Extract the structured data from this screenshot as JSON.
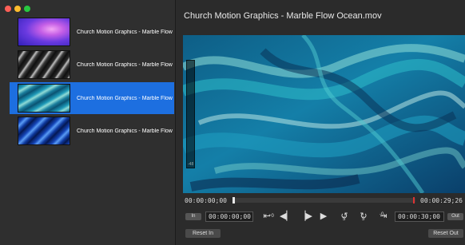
{
  "window": {
    "title": "Church Motion Graphics - Marble Flow Ocean.mov",
    "traffic_colors": [
      "#ff5f57",
      "#febc2e",
      "#28c840"
    ]
  },
  "playlist": {
    "items": [
      {
        "label": "Church Motion Graphics - Marble Flow Purple.mov",
        "selected": false,
        "thumb_colors": [
          "#4b2fd6",
          "#b04be0",
          "#e57fe8"
        ]
      },
      {
        "label": "Church Motion Graphics - Marble Flow Gray.mov",
        "selected": false,
        "thumb_colors": [
          "#1a1a1a",
          "#777777",
          "#d8d8d8"
        ]
      },
      {
        "label": "Church Motion Graphics - Marble Flow Ocean.mov",
        "selected": true,
        "thumb_colors": [
          "#0d6b8a",
          "#2bb3c9",
          "#a7e3e0"
        ]
      },
      {
        "label": "Church Motion Graphics - Marble Flow Blue.mov",
        "selected": false,
        "thumb_colors": [
          "#0a2a7a",
          "#1f5fd6",
          "#6fb0ff"
        ]
      }
    ],
    "selected_color": "#1d6fe0"
  },
  "player": {
    "current_time": "00:00:00;00",
    "total_time": "00:00:29;26",
    "position_fraction": 0.0,
    "in_button": "In",
    "in_time": "00:00:00;00",
    "out_time": "00:00:30;00",
    "out_button": "Out",
    "reset_in": "Reset In",
    "reset_out": "Reset Out",
    "controls": {
      "go_in": "+0",
      "step_back": "◀|",
      "step_forward": "|▶",
      "play": "▶",
      "back_seconds": "5",
      "forward_seconds": "5",
      "go_out": "-0"
    },
    "meter_mark": "-48",
    "playhead_color": "#d33333"
  }
}
